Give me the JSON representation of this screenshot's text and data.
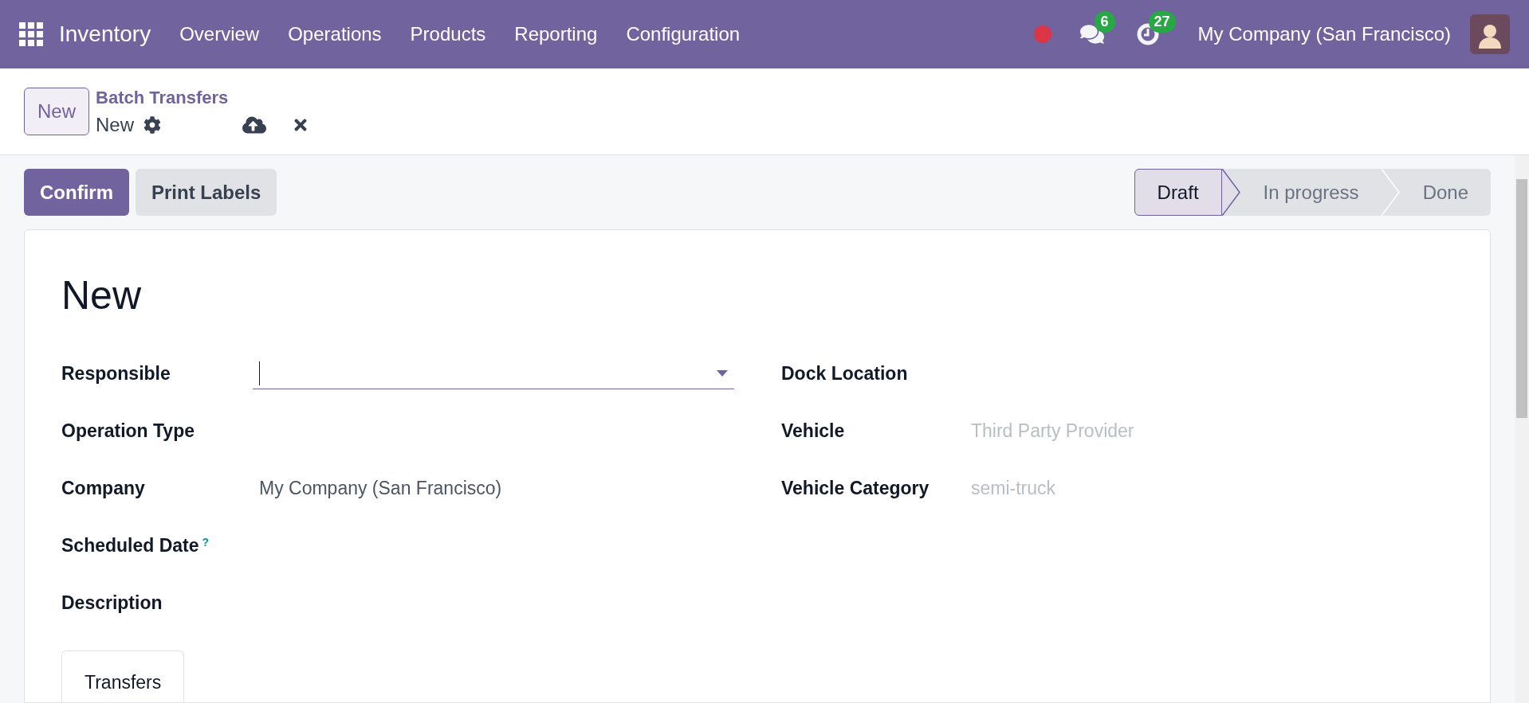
{
  "navbar": {
    "app_name": "Inventory",
    "menu": [
      "Overview",
      "Operations",
      "Products",
      "Reporting",
      "Configuration"
    ],
    "messages_count": "6",
    "activities_count": "27",
    "company": "My Company (San Francisco)"
  },
  "control_panel": {
    "new_button": "New",
    "breadcrumb": "Batch Transfers",
    "record": "New"
  },
  "buttons": [
    {
      "label": "Confirm",
      "kind": "primary"
    },
    {
      "label": "Print Labels",
      "kind": "secondary"
    }
  ],
  "statusbar": [
    {
      "label": "Draft",
      "selected": true
    },
    {
      "label": "In progress",
      "selected": false
    },
    {
      "label": "Done",
      "selected": false
    }
  ],
  "form": {
    "title": "New",
    "left_fields": [
      {
        "label": "Responsible",
        "kind": "dropdown",
        "focused": true
      },
      {
        "label": "Operation Type",
        "kind": "text"
      },
      {
        "label": "Company",
        "kind": "text",
        "value": "My Company (San Francisco)"
      },
      {
        "label": "Scheduled Date",
        "kind": "text",
        "help": "?"
      },
      {
        "label": "Description",
        "kind": "text"
      }
    ],
    "right_fields": [
      {
        "label": "Dock Location"
      },
      {
        "label": "Vehicle",
        "placeholder": "Third Party Provider"
      },
      {
        "label": "Vehicle Category",
        "placeholder": "semi-truck"
      }
    ]
  },
  "tabs": [
    {
      "label": "Transfers",
      "selected": true
    }
  ]
}
